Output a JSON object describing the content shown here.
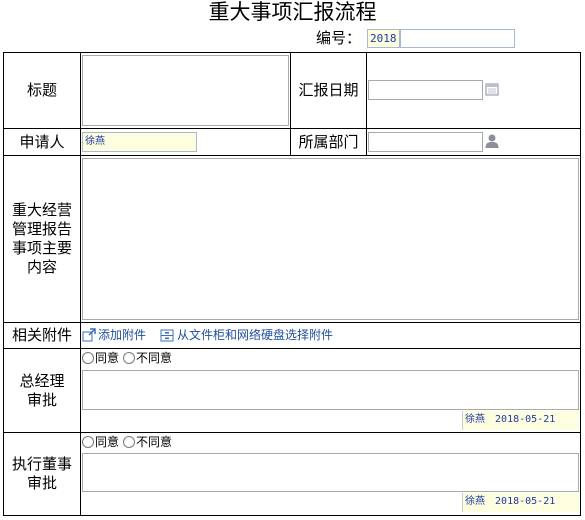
{
  "form": {
    "title": "重大事项汇报流程",
    "serial_label": "编号：",
    "serial_year": "2018",
    "serial_number": ""
  },
  "fields": {
    "title_label": "标题",
    "title_value": "",
    "report_date_label": "汇报日期",
    "report_date_value": "",
    "applicant_label": "申请人",
    "applicant_value": "徐燕",
    "department_label": "所属部门",
    "department_value": "",
    "content_label": "重大经营管理报告事项主要内容",
    "content_value": "",
    "attachments_label": "相关附件",
    "add_attachment": "添加附件",
    "select_attachment": "从文件柜和网络硬盘选择附件"
  },
  "approvals": [
    {
      "label": "总经理审批",
      "agree": "同意",
      "disagree": "不同意",
      "comment": "",
      "signer": "徐燕",
      "date": "2018-05-21"
    },
    {
      "label": "执行董事审批",
      "agree": "同意",
      "disagree": "不同意",
      "comment": "",
      "signer": "徐燕",
      "date": "2018-05-21"
    }
  ],
  "icons": {
    "calendar": "calendar-icon",
    "user_picker": "user-icon",
    "add_attachment": "add-attachment-icon",
    "select_attachment": "file-cabinet-icon"
  },
  "colors": {
    "readonly_bg": "#fdfde0",
    "link": "#1f4f9e",
    "value_text": "#1f3aa6"
  }
}
